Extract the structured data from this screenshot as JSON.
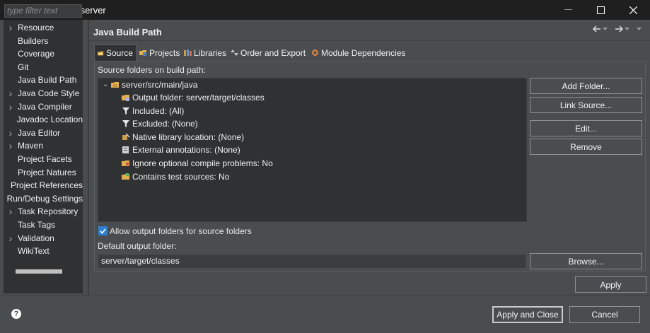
{
  "window": {
    "title": "Properties for server"
  },
  "filter": {
    "placeholder": "type filter text"
  },
  "nav": {
    "items": [
      {
        "label": "Resource",
        "expandable": true
      },
      {
        "label": "Builders",
        "expandable": false
      },
      {
        "label": "Coverage",
        "expandable": false
      },
      {
        "label": "Git",
        "expandable": false
      },
      {
        "label": "Java Build Path",
        "expandable": false,
        "selected": true
      },
      {
        "label": "Java Code Style",
        "expandable": true
      },
      {
        "label": "Java Compiler",
        "expandable": true
      },
      {
        "label": "Javadoc Location",
        "expandable": false
      },
      {
        "label": "Java Editor",
        "expandable": true
      },
      {
        "label": "Maven",
        "expandable": true
      },
      {
        "label": "Project Facets",
        "expandable": false
      },
      {
        "label": "Project Natures",
        "expandable": false
      },
      {
        "label": "Project References",
        "expandable": false
      },
      {
        "label": "Run/Debug Settings",
        "expandable": false
      },
      {
        "label": "Task Repository",
        "expandable": true
      },
      {
        "label": "Task Tags",
        "expandable": false
      },
      {
        "label": "Validation",
        "expandable": true
      },
      {
        "label": "WikiText",
        "expandable": false
      }
    ]
  },
  "page": {
    "title": "Java Build Path"
  },
  "tabs": [
    {
      "label": "Source",
      "icon": "source-folder-icon",
      "active": true
    },
    {
      "label": "Projects",
      "icon": "projects-icon"
    },
    {
      "label": "Libraries",
      "icon": "libraries-icon"
    },
    {
      "label": "Order and Export",
      "icon": "order-export-icon"
    },
    {
      "label": "Module Dependencies",
      "icon": "module-icon"
    }
  ],
  "source": {
    "folders_label": "Source folders on build path:",
    "root": "server/src/main/java",
    "children": [
      {
        "label": "Output folder: server/target/classes",
        "icon": "output-folder-icon"
      },
      {
        "label": "Included: (All)",
        "icon": "filter-icon"
      },
      {
        "label": "Excluded: (None)",
        "icon": "filter-icon"
      },
      {
        "label": "Native library location: (None)",
        "icon": "native-lib-icon"
      },
      {
        "label": "External annotations: (None)",
        "icon": "annotations-icon"
      },
      {
        "label": "Ignore optional compile problems: No",
        "icon": "ignore-problems-icon"
      },
      {
        "label": "Contains test sources: No",
        "icon": "test-sources-icon"
      }
    ],
    "buttons": {
      "add_folder": "Add Folder...",
      "link_source": "Link Source...",
      "edit": "Edit...",
      "remove": "Remove",
      "browse": "Browse..."
    },
    "allow_output_label": "Allow output folders for source folders",
    "allow_output_checked": true,
    "default_output_label": "Default output folder:",
    "default_output_value": "server/target/classes"
  },
  "footer": {
    "apply": "Apply",
    "apply_close": "Apply and Close",
    "cancel": "Cancel"
  },
  "colors": {
    "background": "#4a4d50",
    "panel": "#2f3133",
    "titlebar": "#1f1f1f",
    "checkbox": "#2f7fd0"
  }
}
